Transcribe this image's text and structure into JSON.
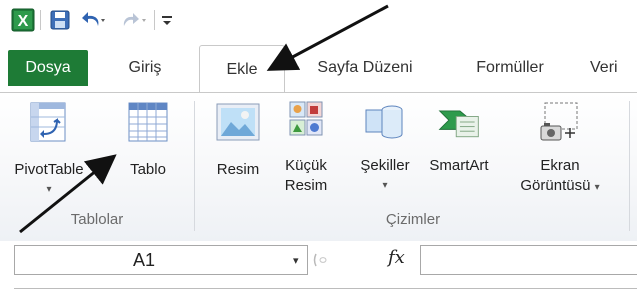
{
  "quick_access": {
    "icons": [
      "excel-logo-icon",
      "save-icon",
      "undo-icon",
      "redo-icon",
      "customize-dropdown-icon"
    ],
    "excel_letter": "X"
  },
  "tabs": {
    "file": "Dosya",
    "home": "Giriş",
    "insert": "Ekle",
    "page_layout": "Sayfa Düzeni",
    "formulas": "Formüller",
    "data_partial": "Veri"
  },
  "ribbon": {
    "groups": {
      "tables": {
        "label": "Tablolar",
        "pivot_label": "PivotTable",
        "table_label": "Tablo"
      },
      "illustrations": {
        "label": "Çizimler",
        "picture_label": "Resim",
        "clipart_line1": "Küçük",
        "clipart_line2": "Resim",
        "shapes_label": "Şekiller",
        "smartart_label": "SmartArt",
        "screenshot_line1": "Ekran",
        "screenshot_line2": "Görüntüsü",
        "dropdown_glyph": "▾"
      }
    }
  },
  "formula_bar": {
    "name_box_value": "A1",
    "name_box_dropdown": "▾",
    "fx_label": "fx"
  },
  "colors": {
    "file_tab": "#1e7b36",
    "arrow": "#111111",
    "ribbon_border": "#c9c9c9"
  }
}
